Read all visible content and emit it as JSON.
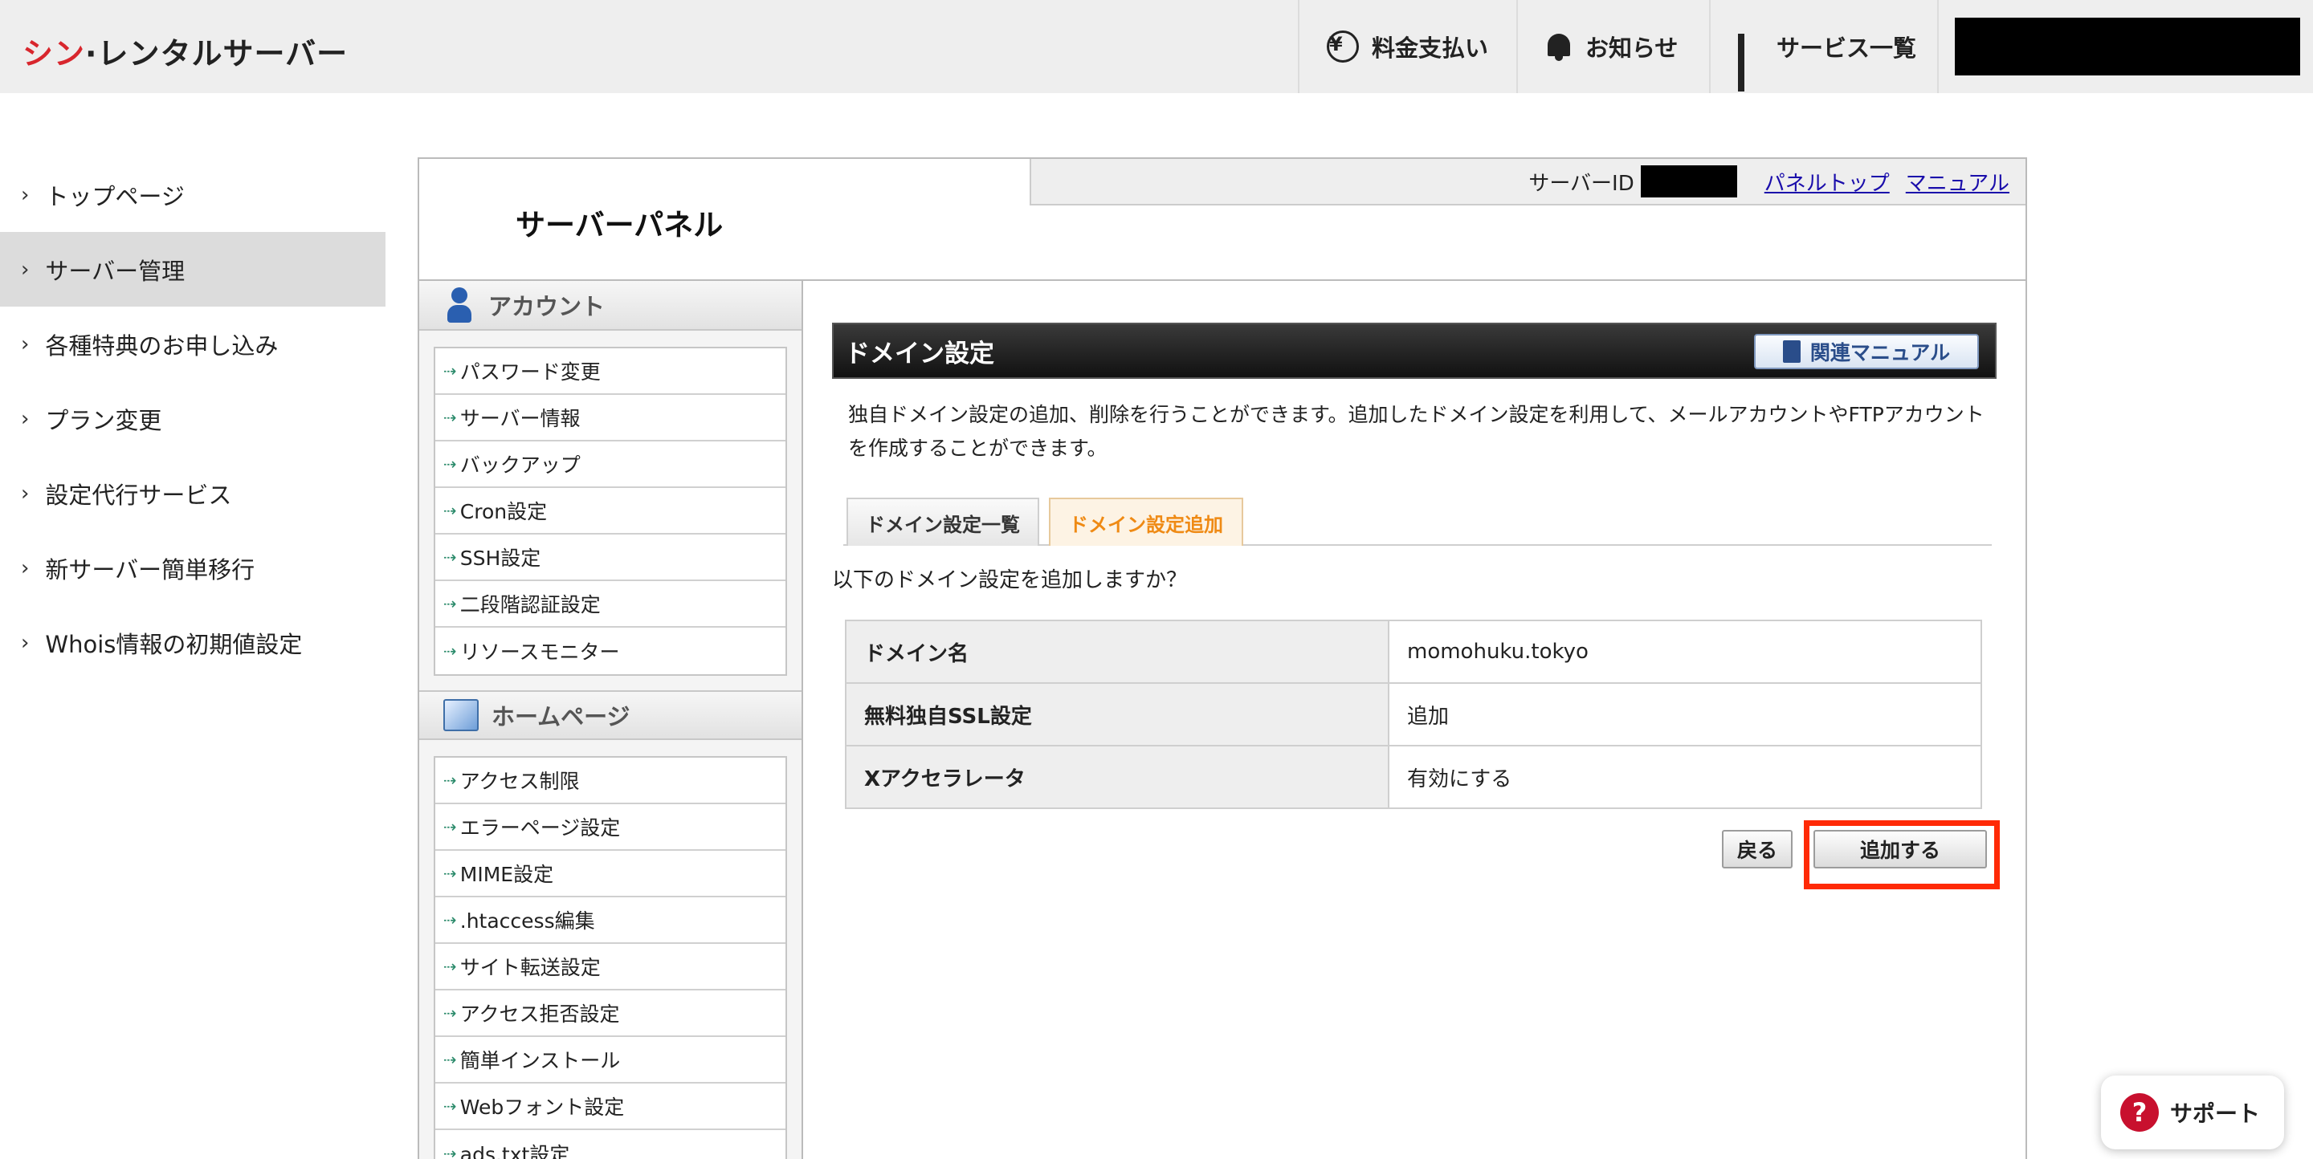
{
  "header": {
    "logo_accent": "シン",
    "logo_rest": "·レンタルサーバー",
    "nav": {
      "payment": "料金支払い",
      "news": "お知らせ",
      "services": "サービス一覧"
    }
  },
  "sidebar": {
    "items": [
      {
        "label": "トップページ",
        "active": false
      },
      {
        "label": "サーバー管理",
        "active": true
      },
      {
        "label": "各種特典のお申し込み",
        "active": false
      },
      {
        "label": "プラン変更",
        "active": false
      },
      {
        "label": "設定代行サービス",
        "active": false
      },
      {
        "label": "新サーバー簡単移行",
        "active": false
      },
      {
        "label": "Whois情報の初期値設定",
        "active": false
      }
    ]
  },
  "panel": {
    "title": "サーバーパネル",
    "server_id_label": "サーバーID",
    "panel_top_link": "パネルトップ",
    "manual_link": "マニュアル"
  },
  "menu": {
    "account_head": "アカウント",
    "account_items": [
      "パスワード変更",
      "サーバー情報",
      "バックアップ",
      "Cron設定",
      "SSH設定",
      "二段階認証設定",
      "リソースモニター"
    ],
    "homepage_head": "ホームページ",
    "homepage_items": [
      "アクセス制限",
      "エラーページ設定",
      "MIME設定",
      ".htaccess編集",
      "サイト転送設定",
      "アクセス拒否設定",
      "簡単インストール",
      "Webフォント設定",
      "ads.txt設定"
    ]
  },
  "content": {
    "section_title": "ドメイン設定",
    "manual_button": "関連マニュアル",
    "description": "独自ドメイン設定の追加、削除を行うことができます。追加したドメイン設定を利用して、メールアカウントやFTPアカウントを作成することができます。",
    "tabs": [
      {
        "label": "ドメイン設定一覧",
        "active": false
      },
      {
        "label": "ドメイン設定追加",
        "active": true
      }
    ],
    "confirm_question": "以下のドメイン設定を追加しますか？",
    "table": [
      {
        "key": "ドメイン名",
        "value": "momohuku.tokyo"
      },
      {
        "key": "無料独自SSL設定",
        "value": "追加"
      },
      {
        "key": "Xアクセラレータ",
        "value": "有効にする"
      }
    ],
    "back_button": "戻る",
    "add_button": "追加する"
  },
  "support": {
    "label": "サポート"
  },
  "colors": {
    "brand_red": "#d8262d",
    "highlight": "#ff2a06",
    "tab_active": "#ef8a14"
  }
}
